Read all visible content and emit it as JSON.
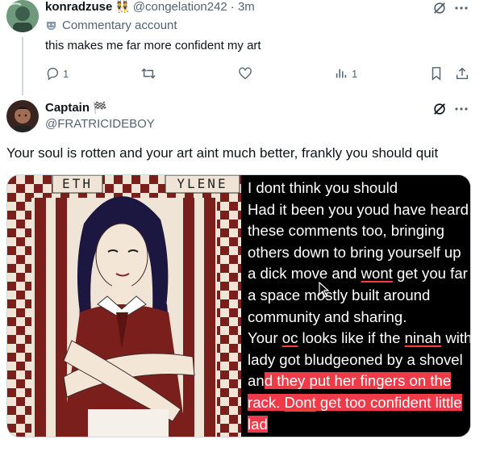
{
  "tweet1": {
    "name": "konradzuse",
    "badge_emoji": "👯",
    "handle": "@congelation242",
    "time": "· 3m",
    "account_type_label": "Commentary account",
    "text": "this makes me far more confident my art",
    "actions": {
      "reply_count": "1",
      "repost_count": "",
      "like_count": "",
      "views_count": "1"
    }
  },
  "tweet2": {
    "name": "Captain",
    "flag_emoji": "🏁",
    "handle": "@FRATRICIDEBOY",
    "text": "Your soul is rotten and your art aint much better, frankly you should quit",
    "image": {
      "art_title_left": "ETH",
      "art_title_right": "YLENE",
      "text_lines": [
        {
          "parts": [
            {
              "t": "I dont think you should"
            }
          ]
        },
        {
          "parts": [
            {
              "t": "Had it been you youd have heard"
            }
          ]
        },
        {
          "parts": [
            {
              "t": "these comments too, bringing"
            }
          ]
        },
        {
          "parts": [
            {
              "t": "others down to bring yourself up"
            }
          ]
        },
        {
          "parts": [
            {
              "t": "a dick move and "
            },
            {
              "t": "wont",
              "u": true
            },
            {
              "t": " get you far"
            }
          ]
        },
        {
          "parts": [
            {
              "t": "a space mostly built around"
            }
          ]
        },
        {
          "parts": [
            {
              "t": "community and sharing."
            }
          ]
        },
        {
          "parts": [
            {
              "t": "Your "
            },
            {
              "t": "oc",
              "u": true
            },
            {
              "t": " looks like if the "
            },
            {
              "t": "ninah",
              "u": true
            },
            {
              "t": " with"
            }
          ]
        },
        {
          "parts": [
            {
              "t": "lady got bludgeoned by a shovel"
            }
          ]
        },
        {
          "parts": [
            {
              "t": "an"
            },
            {
              "t": "d they put her fingers on the",
              "h": true
            }
          ]
        },
        {
          "parts": [
            {
              "t": "rack. ",
              "h": true
            },
            {
              "t": "Dont",
              "h": true,
              "u": true
            },
            {
              "t": " get too confident little",
              "h": true
            }
          ]
        },
        {
          "parts": [
            {
              "t": "lad",
              "h": true
            }
          ]
        }
      ]
    }
  },
  "colors": {
    "accent": "#1d9bf0",
    "muted": "#536471",
    "art_red": "#7a1f1c",
    "art_cream": "#efe4d6",
    "highlight": "#f03a47"
  },
  "icons": [
    "grok-icon",
    "more-icon",
    "reply-icon",
    "repost-icon",
    "like-icon",
    "views-icon",
    "bookmark-icon",
    "share-icon",
    "commentary-mask-icon"
  ]
}
